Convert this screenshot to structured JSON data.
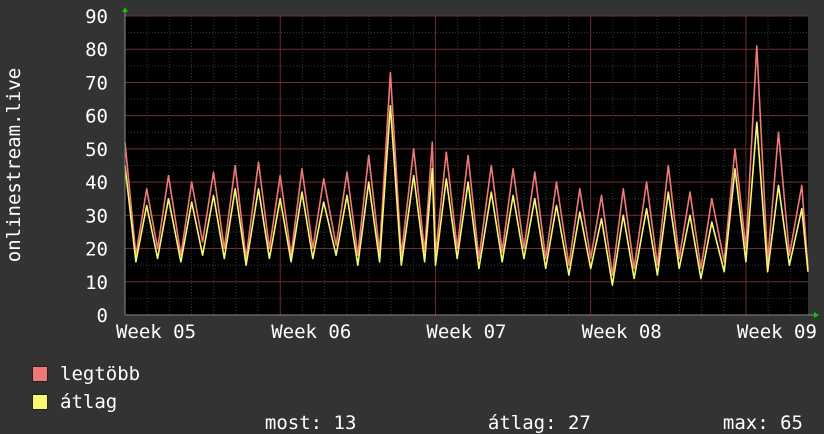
{
  "chart_data": {
    "type": "line",
    "ylabel": "onlinestream.live",
    "ylim": [
      0,
      90
    ],
    "yticks": [
      0,
      10,
      20,
      30,
      40,
      50,
      60,
      70,
      80,
      90
    ],
    "xlim": [
      0,
      4.4
    ],
    "xticks": [
      {
        "label": "Week 05",
        "value": 0
      },
      {
        "label": "Week 06",
        "value": 1
      },
      {
        "label": "Week 07",
        "value": 2
      },
      {
        "label": "Week 08",
        "value": 3
      },
      {
        "label": "Week 09",
        "value": 4
      }
    ],
    "grid": true,
    "series": [
      {
        "name": "legtöbb",
        "color": "#f07878",
        "x": [
          0,
          0.07,
          0.14,
          0.21,
          0.28,
          0.36,
          0.43,
          0.5,
          0.57,
          0.64,
          0.71,
          0.78,
          0.86,
          0.93,
          1,
          1.07,
          1.14,
          1.21,
          1.28,
          1.36,
          1.43,
          1.5,
          1.57,
          1.64,
          1.71,
          1.78,
          1.86,
          1.93,
          1.98,
          2,
          2.07,
          2.14,
          2.21,
          2.28,
          2.36,
          2.43,
          2.5,
          2.57,
          2.64,
          2.71,
          2.78,
          2.86,
          2.93,
          3,
          3.07,
          3.14,
          3.21,
          3.28,
          3.36,
          3.43,
          3.5,
          3.57,
          3.64,
          3.71,
          3.78,
          3.86,
          3.93,
          4,
          4.07,
          4.14,
          4.21,
          4.28,
          4.36,
          4.4
        ],
        "values": [
          52,
          18,
          38,
          20,
          42,
          18,
          40,
          22,
          43,
          20,
          45,
          17,
          46,
          20,
          42,
          18,
          44,
          20,
          41,
          21,
          43,
          18,
          48,
          19,
          73,
          18,
          50,
          19,
          52,
          18,
          49,
          20,
          48,
          17,
          45,
          19,
          44,
          20,
          43,
          17,
          40,
          15,
          38,
          17,
          36,
          12,
          38,
          14,
          40,
          15,
          45,
          17,
          37,
          14,
          35,
          16,
          50,
          20,
          81,
          16,
          55,
          18,
          39,
          14
        ]
      },
      {
        "name": "átlag",
        "color": "#f8f870",
        "x": [
          0,
          0.07,
          0.14,
          0.21,
          0.28,
          0.36,
          0.43,
          0.5,
          0.57,
          0.64,
          0.71,
          0.78,
          0.86,
          0.93,
          1,
          1.07,
          1.14,
          1.21,
          1.28,
          1.36,
          1.43,
          1.5,
          1.57,
          1.64,
          1.71,
          1.78,
          1.86,
          1.93,
          1.98,
          2,
          2.07,
          2.14,
          2.21,
          2.28,
          2.36,
          2.43,
          2.5,
          2.57,
          2.64,
          2.71,
          2.78,
          2.86,
          2.93,
          3,
          3.07,
          3.14,
          3.21,
          3.28,
          3.36,
          3.43,
          3.5,
          3.57,
          3.64,
          3.71,
          3.78,
          3.86,
          3.93,
          4,
          4.07,
          4.14,
          4.21,
          4.28,
          4.36,
          4.4
        ],
        "values": [
          45,
          16,
          33,
          17,
          35,
          16,
          34,
          18,
          36,
          17,
          38,
          15,
          38,
          17,
          35,
          16,
          37,
          17,
          34,
          18,
          36,
          15,
          40,
          16,
          63,
          15,
          42,
          16,
          44,
          15,
          41,
          17,
          40,
          14,
          37,
          16,
          36,
          17,
          35,
          14,
          33,
          12,
          31,
          14,
          29,
          9,
          30,
          11,
          32,
          12,
          37,
          14,
          30,
          11,
          28,
          13,
          44,
          16,
          58,
          13,
          39,
          15,
          32,
          13
        ]
      }
    ],
    "legend": [
      {
        "name": "legtöbb",
        "color": "#f07878"
      },
      {
        "name": "átlag",
        "color": "#f8f870"
      }
    ],
    "stats": {
      "most_label": "most:",
      "most_value": "13",
      "atlag_label": "átlag:",
      "atlag_value": "27",
      "max_label": "max:",
      "max_value": "65"
    }
  }
}
